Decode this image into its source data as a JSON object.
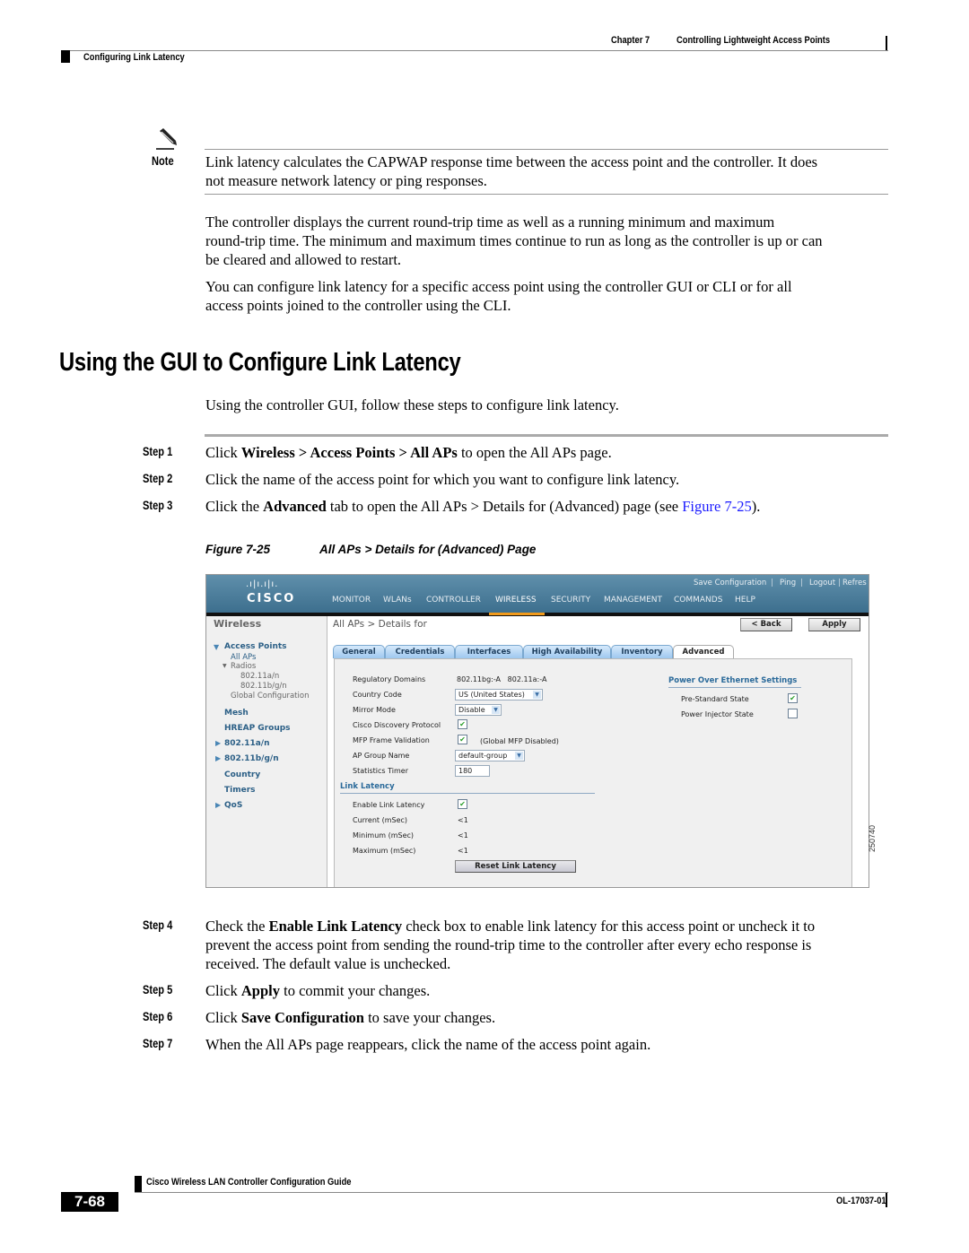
{
  "header": {
    "chapter_label": "Chapter 7",
    "chapter_title": "Controlling Lightweight Access Points",
    "section_title": "Configuring Link Latency"
  },
  "note": {
    "icon": "pencil-note-icon",
    "label": "Note",
    "text_line1": "Link latency calculates the CAPWAP response time between the access point and the controller. It does",
    "text_line2": "not measure network latency or ping responses."
  },
  "paragraphs": [
    {
      "lines": [
        "The controller displays the current round-trip time as well as a running minimum and maximum",
        "round-trip time. The minimum and maximum times continue to run as long as the controller is up or can",
        "be cleared and allowed to restart."
      ]
    },
    {
      "lines": [
        "You can configure link latency for a specific access point using the controller GUI or CLI or for all",
        "access points joined to the controller using the CLI."
      ]
    }
  ],
  "section": {
    "heading": "Using the GUI to Configure Link Latency",
    "intro": "Using the controller GUI, follow these steps to configure link latency."
  },
  "steps": [
    {
      "label": "Step 1",
      "parts": [
        "Click ",
        "Wireless > Access Points > All APs",
        " to open the All APs page."
      ]
    },
    {
      "label": "Step 2",
      "text": "Click the name of the access point for which you want to configure link latency."
    },
    {
      "label": "Step 3",
      "parts": [
        "Click the ",
        "Advanced",
        " tab to open the All APs > Details for (Advanced) page (see ",
        "Figure 7-25",
        ")."
      ]
    },
    {
      "label": "Step 4",
      "parts": [
        "Check the ",
        "Enable Link Latency",
        " check box to enable link latency for this access point or uncheck it to"
      ],
      "line2": "prevent the access point from sending the round-trip time to the controller after every echo response is",
      "line3": "received. The default value is unchecked."
    },
    {
      "label": "Step 5",
      "parts": [
        "Click ",
        "Apply",
        " to commit your changes."
      ]
    },
    {
      "label": "Step 6",
      "parts": [
        "Click ",
        "Save Configuration",
        " to save your changes."
      ]
    },
    {
      "label": "Step 7",
      "text": "When the All APs page reappears, click the name of the access point again."
    }
  ],
  "figure": {
    "number": "Figure 7-25",
    "title": "All APs > Details for (Advanced) Page",
    "figure_id": "250740",
    "gui": {
      "logo_bars": ".ı|ı.ı|ı.",
      "logo_text": "CISCO",
      "top_links": [
        "Save Configuration",
        "Ping",
        "Logout",
        "Refres"
      ],
      "nav": [
        "MONITOR",
        "WLANs",
        "CONTROLLER",
        "WIRELESS",
        "SECURITY",
        "MANAGEMENT",
        "COMMANDS",
        "HELP"
      ],
      "active_nav": "WIRELESS",
      "sidebar": {
        "title": "Wireless",
        "items": [
          {
            "label": "Access Points",
            "type": "bold",
            "expanded": true
          },
          {
            "label": "All APs",
            "type": "sub"
          },
          {
            "label": "Radios",
            "type": "grey",
            "expanded": true
          },
          {
            "label": "802.11a/n",
            "type": "grey"
          },
          {
            "label": "802.11b/g/n",
            "type": "grey"
          },
          {
            "label": "Global Configuration",
            "type": "grey"
          },
          {
            "label": "Mesh",
            "type": "bold"
          },
          {
            "label": "HREAP Groups",
            "type": "bold"
          },
          {
            "label": "802.11a/n",
            "type": "bold",
            "collapsed": true
          },
          {
            "label": "802.11b/g/n",
            "type": "bold",
            "collapsed": true
          },
          {
            "label": "Country",
            "type": "bold"
          },
          {
            "label": "Timers",
            "type": "bold"
          },
          {
            "label": "QoS",
            "type": "bold",
            "collapsed": true
          }
        ]
      },
      "page_title": "All APs > Details for",
      "back_button": "< Back",
      "apply_button": "Apply",
      "tabs": [
        "General",
        "Credentials",
        "Interfaces",
        "High Availability",
        "Inventory",
        "Advanced"
      ],
      "active_tab": "Advanced",
      "fields": {
        "regulatory_domains": {
          "label": "Regulatory Domains",
          "value": "802.11bg:-A   802.11a:-A"
        },
        "country_code": {
          "label": "Country Code",
          "value": "US (United States)"
        },
        "mirror_mode": {
          "label": "Mirror Mode",
          "value": "Disable"
        },
        "cdp": {
          "label": "Cisco Discovery Protocol",
          "checked": true
        },
        "mfp": {
          "label": "MFP Frame Validation",
          "checked": true,
          "note": "(Global MFP Disabled)"
        },
        "ap_group": {
          "label": "AP Group Name",
          "value": "default-group"
        },
        "stats_timer": {
          "label": "Statistics Timer",
          "value": "180"
        }
      },
      "link_latency": {
        "title": "Link Latency",
        "enable": {
          "label": "Enable Link Latency",
          "checked": true
        },
        "current": {
          "label": "Current (mSec)",
          "value": "<1"
        },
        "minimum": {
          "label": "Minimum (mSec)",
          "value": "<1"
        },
        "maximum": {
          "label": "Maximum (mSec)",
          "value": "<1"
        },
        "reset_button": "Reset Link Latency"
      },
      "poe": {
        "title": "Power Over Ethernet Settings",
        "pre_standard": {
          "label": "Pre-Standard State",
          "checked": true
        },
        "power_injector": {
          "label": "Power Injector State",
          "checked": false
        }
      }
    }
  },
  "footer": {
    "guide_title": "Cisco Wireless LAN Controller Configuration Guide",
    "page_number": "7-68",
    "doc_id": "OL-17037-01"
  },
  "check_glyph": "✔",
  "dropdown_glyph": "▼"
}
